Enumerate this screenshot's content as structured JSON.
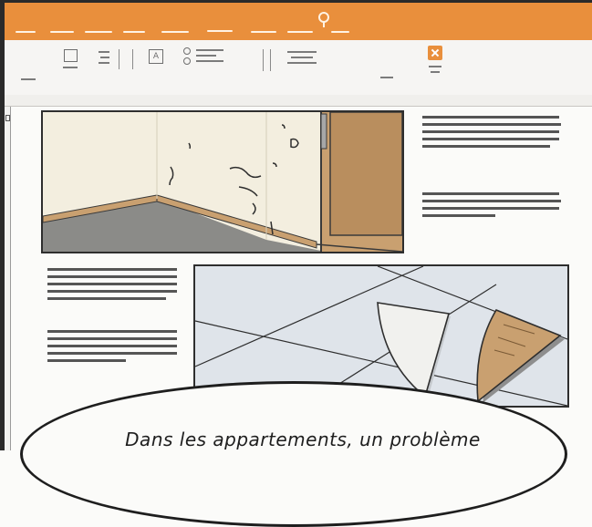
{
  "comic": {
    "caption": "Dans les appartements, un problème"
  },
  "icons": {
    "close": "close-icon",
    "text_box": "text-box-icon",
    "list": "list-icon",
    "align": "align-icon",
    "title_mark": "title-marker-icon"
  },
  "colors": {
    "accent": "#e98f3c",
    "close_button": "#e98f3c",
    "panel_border": "#2e2e2e",
    "wall": "#f3eedf",
    "wood": "#c9a070",
    "floor": "#8b8b88",
    "tiles": "#dfe4ea"
  }
}
